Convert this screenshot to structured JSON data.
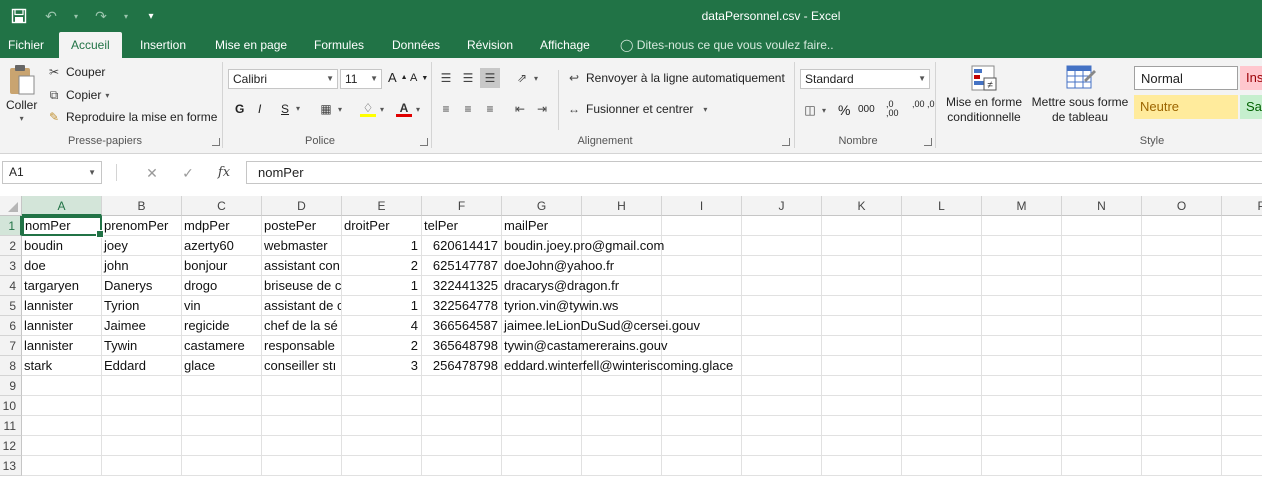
{
  "window": {
    "title": "dataPersonnel.csv - Excel"
  },
  "qat": {
    "save_icon": "save-icon",
    "undo_icon": "undo-icon",
    "redo_icon": "redo-icon"
  },
  "tabs": [
    {
      "label": "Fichier"
    },
    {
      "label": "Accueil"
    },
    {
      "label": "Insertion"
    },
    {
      "label": "Mise en page"
    },
    {
      "label": "Formules"
    },
    {
      "label": "Données"
    },
    {
      "label": "Révision"
    },
    {
      "label": "Affichage"
    }
  ],
  "tellme": "Dites-nous ce que vous voulez faire..",
  "ribbon": {
    "clipboard": {
      "paste": "Coller",
      "cut": "Couper",
      "copy": "Copier",
      "format_painter": "Reproduire la mise en forme",
      "label": "Presse-papiers"
    },
    "font": {
      "name": "Calibri",
      "size": "11",
      "bold": "G",
      "italic": "I",
      "underline": "S",
      "label": "Police"
    },
    "alignment": {
      "wrap": "Renvoyer à la ligne automatiquement",
      "merge": "Fusionner et centrer",
      "label": "Alignement"
    },
    "number": {
      "format": "Standard",
      "percent": "%",
      "thousands": "000",
      "inc_dec": ",0 ,00",
      "dec_dec": ",00 ,0",
      "label": "Nombre"
    },
    "styles": {
      "conditional": [
        "Mise en forme",
        "conditionnelle"
      ],
      "table": [
        "Mettre sous forme",
        "de tableau"
      ],
      "normal": "Normal",
      "insuffisant": "Ins",
      "neutre": "Neutre",
      "satisfaisant": "Sat",
      "label": "Style"
    }
  },
  "formula_bar": {
    "name_box": "A1",
    "content": "nomPer"
  },
  "sheet": {
    "columns": [
      "A",
      "B",
      "C",
      "D",
      "E",
      "F",
      "G",
      "H",
      "I",
      "J",
      "K",
      "L",
      "M",
      "N",
      "O",
      "P"
    ],
    "row_numbers": [
      "1",
      "2",
      "3",
      "4",
      "5",
      "6",
      "7",
      "8",
      "9",
      "10",
      "11",
      "12",
      "13"
    ],
    "headers": [
      "nomPer",
      "prenomPer",
      "mdpPer",
      "postePer",
      "droitPer",
      "telPer",
      "mailPer"
    ],
    "rows": [
      [
        "boudin",
        "joey",
        "azerty60",
        "webmaster",
        "1",
        "620614417",
        "boudin.joey.pro@gmail.com"
      ],
      [
        "doe",
        "john",
        "bonjour",
        "assistant con",
        "2",
        "625147787",
        "doeJohn@yahoo.fr"
      ],
      [
        "targaryen",
        "Danerys",
        "drogo",
        "briseuse de c",
        "1",
        "322441325",
        "dracarys@dragon.fr"
      ],
      [
        "lannister",
        "Tyrion",
        "vin",
        "assistant de c",
        "1",
        "322564778",
        "tyrion.vin@tywin.ws"
      ],
      [
        "lannister",
        "Jaimee",
        "regicide",
        "chef de la sé",
        "4",
        "366564587",
        "jaimee.leLionDuSud@cersei.gouv"
      ],
      [
        "lannister",
        "Tywin",
        "castamere",
        "responsable",
        "2",
        "365648798",
        "tywin@castamererains.gouv"
      ],
      [
        "stark",
        "Eddard",
        "glace",
        "conseiller stı",
        "3",
        "256478798",
        "eddard.winterfell@winteriscoming.glace"
      ]
    ],
    "active_cell": "A1"
  }
}
